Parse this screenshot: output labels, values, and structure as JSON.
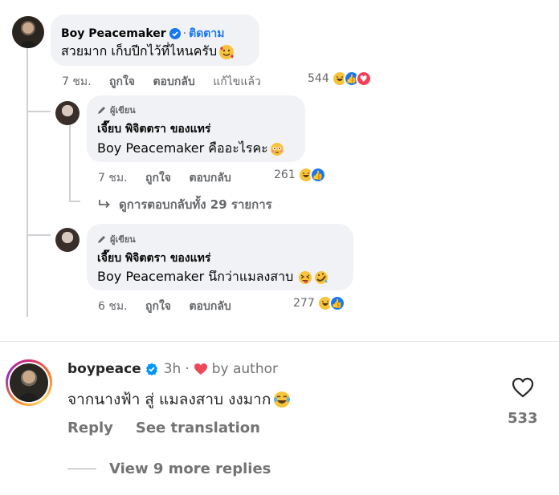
{
  "fb_comment": {
    "name": "Boy Peacemaker",
    "follow": "ติดตาม",
    "text": "สวยมาก เก็บปีกไว้ที่ไหนครับ",
    "text_emoji": "smiling-face-with-hearts",
    "time": "7 ชม.",
    "like": "ถูกใจ",
    "reply": "ตอบกลับ",
    "edited": "แก้ไขแล้ว",
    "reaction_count": "544",
    "reactions": [
      "haha",
      "like",
      "love"
    ]
  },
  "fb_reply_1": {
    "author_tag": "ผู้เขียน",
    "name": "เจี๊ยบ พิจิตตรา ของแทร่",
    "text": "Boy Peacemaker คืออะไรคะ",
    "text_emoji": "flushed-face",
    "time": "7 ชม.",
    "like": "ถูกใจ",
    "reply": "ตอบกลับ",
    "reaction_count": "261",
    "reactions": [
      "haha",
      "like"
    ]
  },
  "fb_view_replies": "ดูการตอบกลับทั้ง 29 รายการ",
  "fb_reply_2": {
    "author_tag": "ผู้เขียน",
    "name": "เจี๊ยบ พิจิตตรา ของแทร่",
    "text": "Boy Peacemaker นึกว่าแมลงสาบ",
    "text_emoji": "squinting-tongue-rofl",
    "time": "6 ชม.",
    "like": "ถูกใจ",
    "reply": "ตอบกลับ",
    "reaction_count": "277",
    "reactions": [
      "haha",
      "like"
    ]
  },
  "ig_comment": {
    "username": "boypeace",
    "time": "3h",
    "dot": "·",
    "by_author": "by author",
    "text": "จากนางฟ้า สู่ แมลงสาบ งงมาก",
    "text_emoji": "tears-of-joy",
    "reply": "Reply",
    "see_translation": "See translation",
    "like_count": "533",
    "view_more": "View 9 more replies"
  },
  "colors": {
    "fb_blue": "#1877f2",
    "fb_bubble": "#f0f2f5",
    "fb_gray": "#65676b",
    "ig_text": "#262626",
    "ig_gray": "#737373",
    "ig_heart": "#ed4956",
    "ig_verified": "#0095f6"
  }
}
